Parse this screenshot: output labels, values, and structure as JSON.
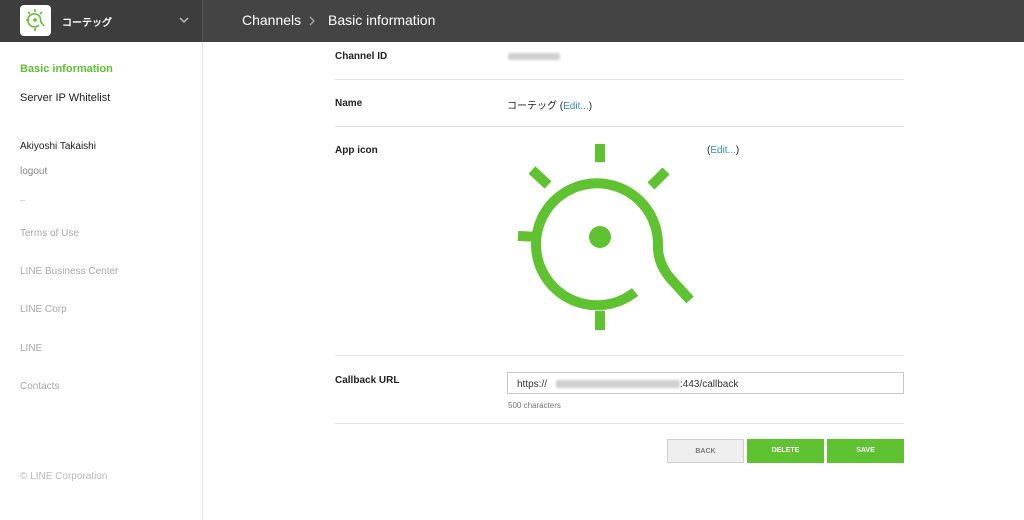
{
  "brand": {
    "name": "コーテッグ",
    "logo_icon": "bulb-logo-icon",
    "menu_icon": "chevron-down-icon"
  },
  "breadcrumb": {
    "root": "Channels",
    "separator_icon": "chevron-right-icon",
    "current": "Basic information"
  },
  "sidebar": {
    "nav": [
      {
        "label": "Basic information",
        "active": true
      },
      {
        "label": "Server IP Whitelist",
        "active": false
      }
    ],
    "user": {
      "name": "Akiyoshi Takaishi",
      "logout": "logout"
    },
    "separator": "–",
    "links": [
      "Terms of Use",
      "LINE Business Center",
      "LINE Corp",
      "LINE",
      "Contacts"
    ],
    "copyright": "© LINE Corporation"
  },
  "fields": {
    "channel_id": {
      "label": "Channel ID"
    },
    "name": {
      "label": "Name",
      "value": "コーテッグ",
      "edit_open": "(",
      "edit": "Edit...",
      "edit_close": ")"
    },
    "app_icon": {
      "label": "App icon",
      "edit_open": "(",
      "edit": "Edit...",
      "edit_close": ")",
      "icon": "bulb-app-icon"
    },
    "callback_url": {
      "label": "Callback URL",
      "prefix": "https://",
      "suffix": ":443/callback",
      "hint": "500 characters"
    }
  },
  "buttons": {
    "back": "BACK",
    "delete": "DELETE",
    "save": "SAVE"
  },
  "colors": {
    "accent": "#5ec231",
    "topbar": "#444444",
    "link": "#2f8ad1"
  }
}
